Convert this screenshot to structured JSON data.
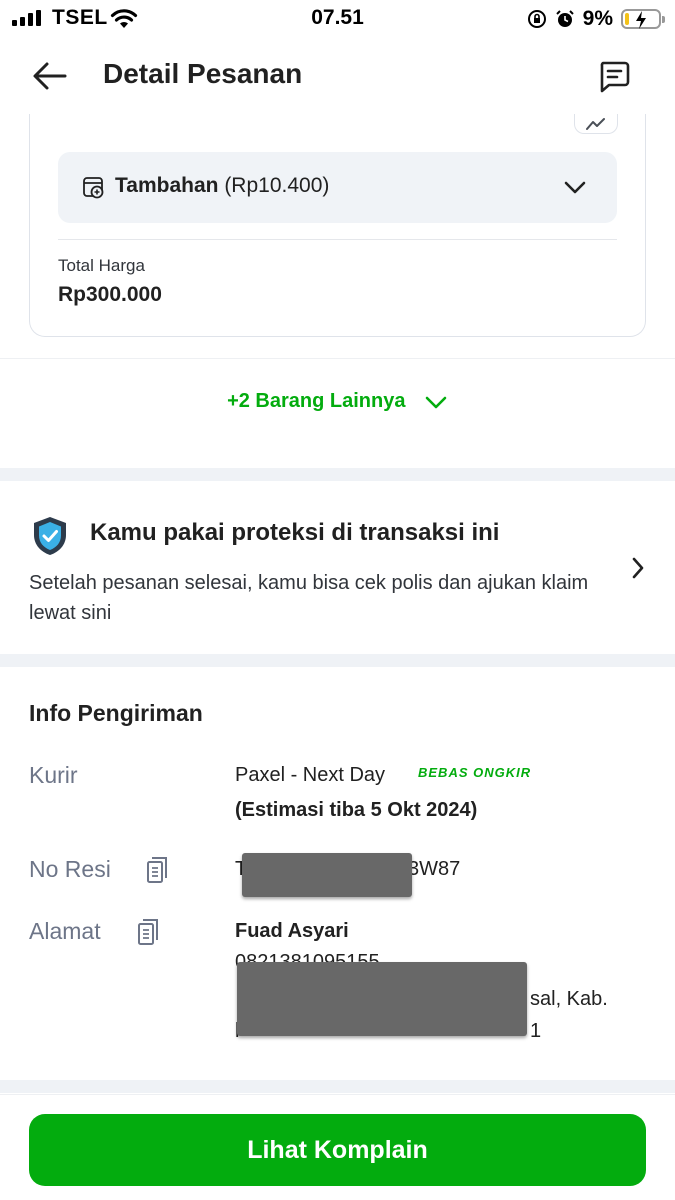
{
  "status_bar": {
    "carrier": "TSEL",
    "time": "07.51",
    "battery": "9%"
  },
  "header": {
    "title": "Detail Pesanan"
  },
  "product": {
    "addon_title": "Tambahan",
    "addon_amount": "(Rp10.400)",
    "total_label": "Total Harga",
    "total_value": "Rp300.000"
  },
  "more_items": {
    "label": "+2 Barang Lainnya"
  },
  "protection": {
    "title": "Kamu pakai proteksi di transaksi ini",
    "description": "Setelah pesanan selesai, kamu bisa cek polis dan ajukan klaim lewat sini"
  },
  "shipping": {
    "title": "Info Pengiriman",
    "courier_label": "Kurir",
    "courier_value": "Paxel - Next Day",
    "free_shipping_badge": "BEBAS ONGKIR",
    "estimate": "(Estimasi tiba 5 Okt 2024)",
    "resi_label": "No Resi",
    "resi_prefix": "T",
    "resi_suffix": "3W87",
    "address_label": "Alamat",
    "recipient_name": "Fuad Asyari",
    "address_phone_partial": "0821381095155",
    "address_line2_partial": "sal, Kab.",
    "address_line3_start": "l",
    "address_line3_end": "1"
  },
  "footer": {
    "cta_label": "Lihat Komplain"
  },
  "colors": {
    "brand_green": "#03AC0E",
    "text_primary": "#212121",
    "text_secondary": "#6D7588",
    "band_gray": "#EFF2F6"
  }
}
